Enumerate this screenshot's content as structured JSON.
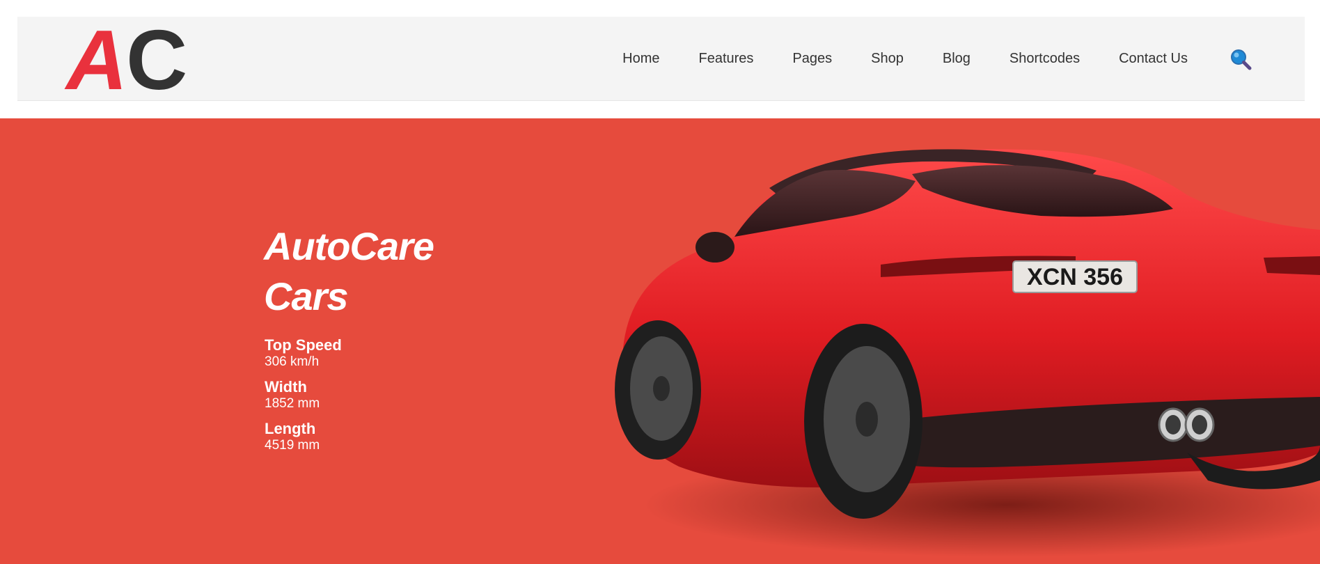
{
  "logo": {
    "a": "A",
    "c": "C"
  },
  "nav": {
    "items": [
      "Home",
      "Features",
      "Pages",
      "Shop",
      "Blog",
      "Shortcodes",
      "Contact Us"
    ],
    "search_icon": "search-icon"
  },
  "hero": {
    "title_line1": "AutoCare",
    "title_line2": "Cars",
    "specs": [
      {
        "label": "Top Speed",
        "value": "306 km/h"
      },
      {
        "label": "Width",
        "value": "1852 mm"
      },
      {
        "label": "Length",
        "value": "4519 mm"
      }
    ],
    "plate": "XCN 356"
  },
  "colors": {
    "brand_red": "#e9313d",
    "hero_background": "#e64b3d",
    "header_background": "#f4f4f4",
    "text_dark": "#333333",
    "search_icon_blue": "#1f8ad6"
  }
}
